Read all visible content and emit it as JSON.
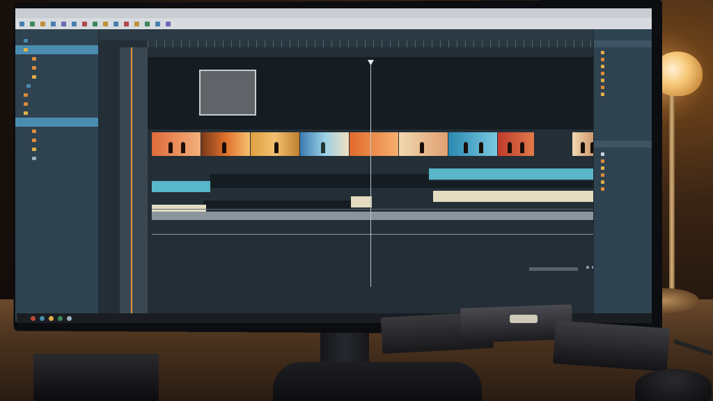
{
  "window": {
    "title": "",
    "menus": [
      "",
      "",
      "",
      "",
      "",
      "",
      "",
      "",
      "",
      "",
      ""
    ]
  },
  "toolbar": {
    "buttons": [
      "",
      "",
      "",
      "",
      "",
      "",
      "",
      "",
      "",
      "",
      "",
      "",
      "",
      "",
      ""
    ]
  },
  "timeline_header": {
    "timecode": "",
    "tabs": [
      "",
      "",
      "",
      "",
      "",
      ""
    ]
  },
  "preview": {
    "label": ""
  },
  "left_panel": {
    "items": [
      {
        "label": "",
        "selected": false
      },
      {
        "label": "",
        "selected": true
      },
      {
        "label": "",
        "selected": false
      },
      {
        "label": "",
        "selected": false
      },
      {
        "label": "",
        "selected": false
      },
      {
        "label": "",
        "selected": false
      },
      {
        "label": "",
        "selected": false
      },
      {
        "label": "",
        "selected": false
      },
      {
        "label": "",
        "selected": true
      },
      {
        "label": "",
        "selected": false
      },
      {
        "label": "",
        "selected": false
      },
      {
        "label": "",
        "selected": false
      },
      {
        "label": "",
        "selected": false
      },
      {
        "label": "",
        "selected": false
      }
    ]
  },
  "clips": {
    "track_label": "",
    "center_label": "",
    "right_label": "",
    "title_clip": ""
  },
  "status": {
    "left": ""
  },
  "right_panel": {
    "sections": [
      "",
      ""
    ],
    "items": [
      "",
      "",
      "",
      "",
      "",
      "",
      "",
      "",
      "",
      "",
      "",
      "",
      ""
    ]
  },
  "colors": {
    "accent_cyan": "#58b7c9",
    "accent_cream": "#e3dcc0",
    "playhead_orange": "#e09a3a",
    "selection_blue": "#4a8db0"
  }
}
